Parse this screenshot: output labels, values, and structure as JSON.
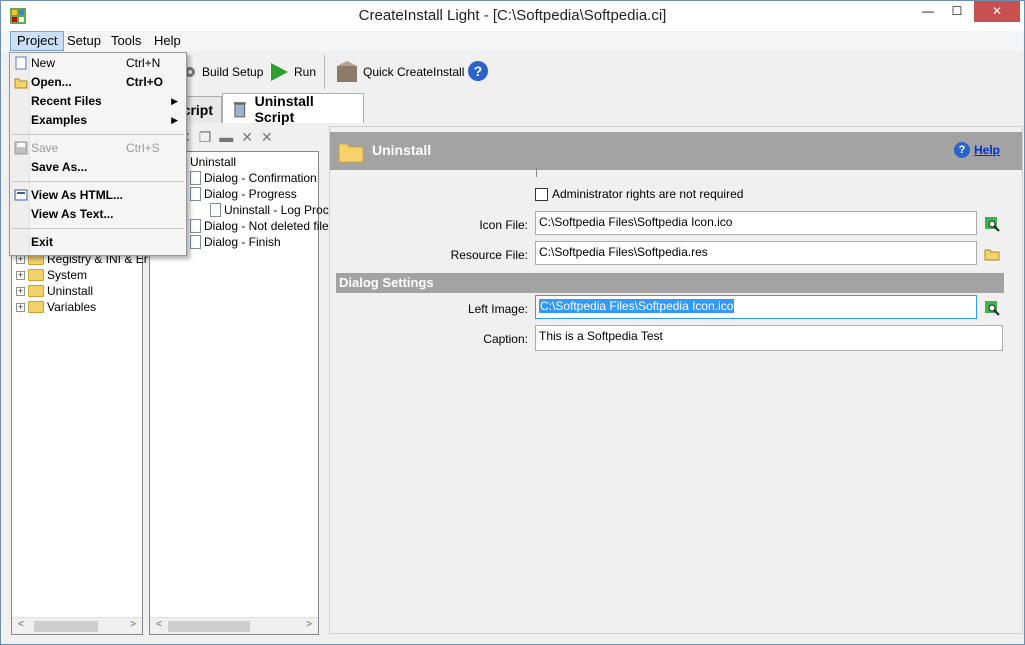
{
  "window": {
    "title": "CreateInstall Light - [C:\\Softpedia\\Softpedia.ci]",
    "min": "—",
    "max": "☐",
    "close": "✕"
  },
  "menubar": [
    "Project",
    "Setup",
    "Tools",
    "Help"
  ],
  "project_menu": {
    "items": [
      {
        "label": "New",
        "shortcut": "Ctrl+N"
      },
      {
        "label": "Open...",
        "shortcut": "Ctrl+O"
      },
      {
        "label": "Recent Files",
        "submenu": true
      },
      {
        "label": "Examples",
        "submenu": true
      },
      {
        "label": "Save",
        "shortcut": "Ctrl+S",
        "disabled": true
      },
      {
        "label": "Save As..."
      },
      {
        "label": "View As HTML..."
      },
      {
        "label": "View As Text..."
      },
      {
        "label": "Exit"
      }
    ]
  },
  "toolbar": {
    "build_setup": "Build Setup",
    "run": "Run",
    "quick": "Quick CreateInstall"
  },
  "tabs": {
    "partial": "cript",
    "uninstall": "Uninstall Script"
  },
  "left_tree": [
    "Registry & INI & Er",
    "System",
    "Uninstall",
    "Variables"
  ],
  "script_tree": [
    "Uninstall",
    "Dialog - Confirmation",
    "Dialog - Progress",
    "Uninstall - Log Proc",
    "Dialog - Not deleted file",
    "Dialog - Finish"
  ],
  "details": {
    "title": "Uninstall",
    "help": "Help",
    "admin_checkbox": "Administrator rights are not required",
    "admin_checked": false,
    "icon_file_label": "Icon File:",
    "icon_file": "C:\\Softpedia Files\\Softpedia Icon.ico",
    "resource_file_label": "Resource File:",
    "resource_file": "C:\\Softpedia Files\\Softpedia.res",
    "dialog_section": "Dialog Settings",
    "left_image_label": "Left Image:",
    "left_image": "C:\\Softpedia Files\\Softpedia Icon.ico",
    "caption_label": "Caption:",
    "caption": "This is a Softpedia Test"
  },
  "colors": {
    "header_gray": "#a3a3a3",
    "selection": "#3399ff",
    "close_red": "#c75050"
  }
}
